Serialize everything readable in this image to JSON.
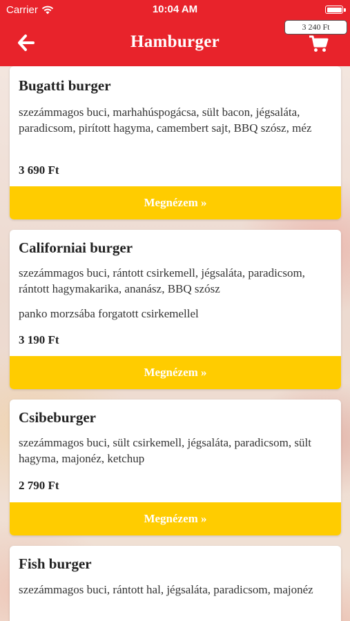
{
  "status_bar": {
    "carrier": "Carrier",
    "time": "10:04 AM"
  },
  "nav": {
    "title": "Hamburger",
    "cart_total": "3 240 Ft",
    "back_icon": "arrow-left-icon",
    "cart_icon": "cart-icon"
  },
  "colors": {
    "header": "#e8232b",
    "button": "#ffcc00"
  },
  "products": [
    {
      "name": "Bugatti burger",
      "description": "szezámmagos buci, marhahúspogácsa, sült bacon, jégsaláta, paradicsom, pirított hagyma, camembert sajt, BBQ szósz, méz",
      "extra": "",
      "price": "3 690 Ft",
      "button": "Megnézem »"
    },
    {
      "name": "Californiai burger",
      "description": "szezámmagos buci, rántott csirkemell, jégsaláta, paradicsom, rántott hagymakarika, ananász, BBQ szósz",
      "extra": "panko morzsába forgatott csirkemellel",
      "price": "3 190 Ft",
      "button": "Megnézem »"
    },
    {
      "name": "Csibeburger",
      "description": "szezámmagos buci, sült csirkemell, jégsaláta, paradicsom, sült hagyma, majonéz, ketchup",
      "extra": "",
      "price": "2 790 Ft",
      "button": "Megnézem »"
    },
    {
      "name": "Fish burger",
      "description": "szezámmagos buci, rántott hal, jégsaláta, paradicsom, majonéz",
      "extra": "",
      "price": "",
      "button": ""
    }
  ]
}
